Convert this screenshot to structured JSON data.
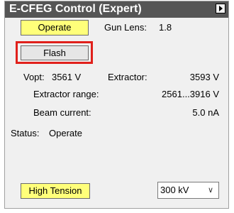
{
  "window": {
    "title": "E-CFEG Control (Expert)"
  },
  "controls": {
    "operate_label": "Operate",
    "flash_label": "Flash",
    "high_tension_label": "High Tension"
  },
  "readouts": {
    "gun_lens_label": "Gun Lens:",
    "gun_lens_value": "1.8",
    "vopt_label": "Vopt:",
    "vopt_value": "3561 V",
    "extractor_label": "Extractor:",
    "extractor_value": "3593 V",
    "extractor_range_label": "Extractor range:",
    "extractor_range_value": "2561...3916 V",
    "beam_current_label": "Beam current:",
    "beam_current_value": "5.0 nA",
    "status_label": "Status:",
    "status_value": "Operate"
  },
  "voltage_select": {
    "selected": "300 kV"
  },
  "colors": {
    "titlebar": "#555555",
    "button_yellow": "#ffff7a",
    "highlight_red": "#e0201b"
  },
  "icons": {
    "title_menu": "triangle-right-icon",
    "dropdown": "chevron-down-icon"
  }
}
